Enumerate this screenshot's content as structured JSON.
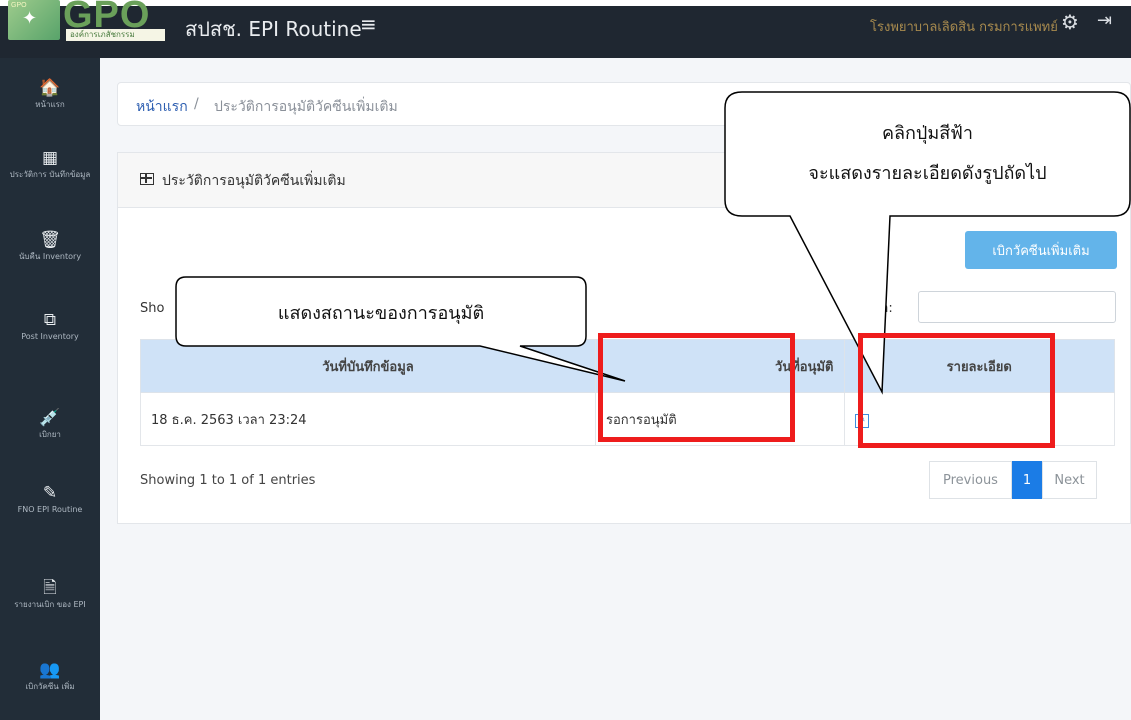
{
  "topbar": {
    "logo_text": "GPO",
    "logo_emblem_label": "GPO",
    "logo_sub": "องค์การเภสัชกรรม",
    "title": "สปสช. EPI Routine",
    "menu_icon": "≡",
    "hospital": "โรงพยาบาลเลิดสิน กรมการแพทย์",
    "settings_icon": "gear-icon",
    "signout_icon": "sign-out-icon"
  },
  "sidebar": {
    "items": [
      {
        "icon": "home-icon",
        "glyph": "🏠",
        "label": "หน้าแรก"
      },
      {
        "icon": "calendar-icon",
        "glyph": "▦",
        "label": "ประวัติการ บันทึกข้อมูล"
      },
      {
        "icon": "trash-icon",
        "glyph": "🗑",
        "label": "นับคืน Inventory"
      },
      {
        "icon": "copy-icon",
        "glyph": "⧉",
        "label": "Post Inventory"
      },
      {
        "icon": "syringe-icon",
        "glyph": "💉",
        "label": "เบิกยา"
      },
      {
        "icon": "pen-icon",
        "glyph": "✎",
        "label": "FNO EPI Routine"
      },
      {
        "icon": "file-icon",
        "glyph": "🗎",
        "label": "รายงานเบิก ของ EPI"
      },
      {
        "icon": "people-icon",
        "glyph": "👥",
        "label": "เบิกวัคซีน เพิ่ม"
      }
    ]
  },
  "breadcrumb": {
    "home": "หน้าแรก",
    "separator": "/",
    "current": "ประวัติการอนุมัติวัคซีนเพิ่มเติม"
  },
  "card": {
    "title": "ประวัติการอนุมัติวัคซีนเพิ่มเติม",
    "request_button": "เบิกวัคซีนเพิ่มเติม",
    "show_label": "Sho",
    "search_label": "ch:",
    "search_value": ""
  },
  "table": {
    "headers": [
      "วันที่บันทึกข้อมูล",
      "วันที่อนุมัติ",
      "รายละเอียด"
    ],
    "rows": [
      {
        "date": "18 ธ.ค. 2563 เวลา 23:24",
        "approval": "รอการอนุมัติ",
        "detail_icon": "edit-icon"
      }
    ]
  },
  "footer": {
    "info": "Showing 1 to 1 of 1 entries",
    "prev": "Previous",
    "page": "1",
    "next": "Next"
  },
  "annotations": {
    "callout_left": "แสดงสถานะของการอนุมัติ",
    "callout_right_line1": "คลิกปุ่มสีฟ้า",
    "callout_right_line2": "จะแสดงรายละเอียดดังรูปถัดไป",
    "box_color": "#ee1c1c"
  },
  "colors": {
    "topbar": "#1f2731",
    "sidebar": "#222d38",
    "table_header": "#cfe2f7",
    "primary": "#1b7ce6",
    "request_button": "#63b4ea"
  }
}
